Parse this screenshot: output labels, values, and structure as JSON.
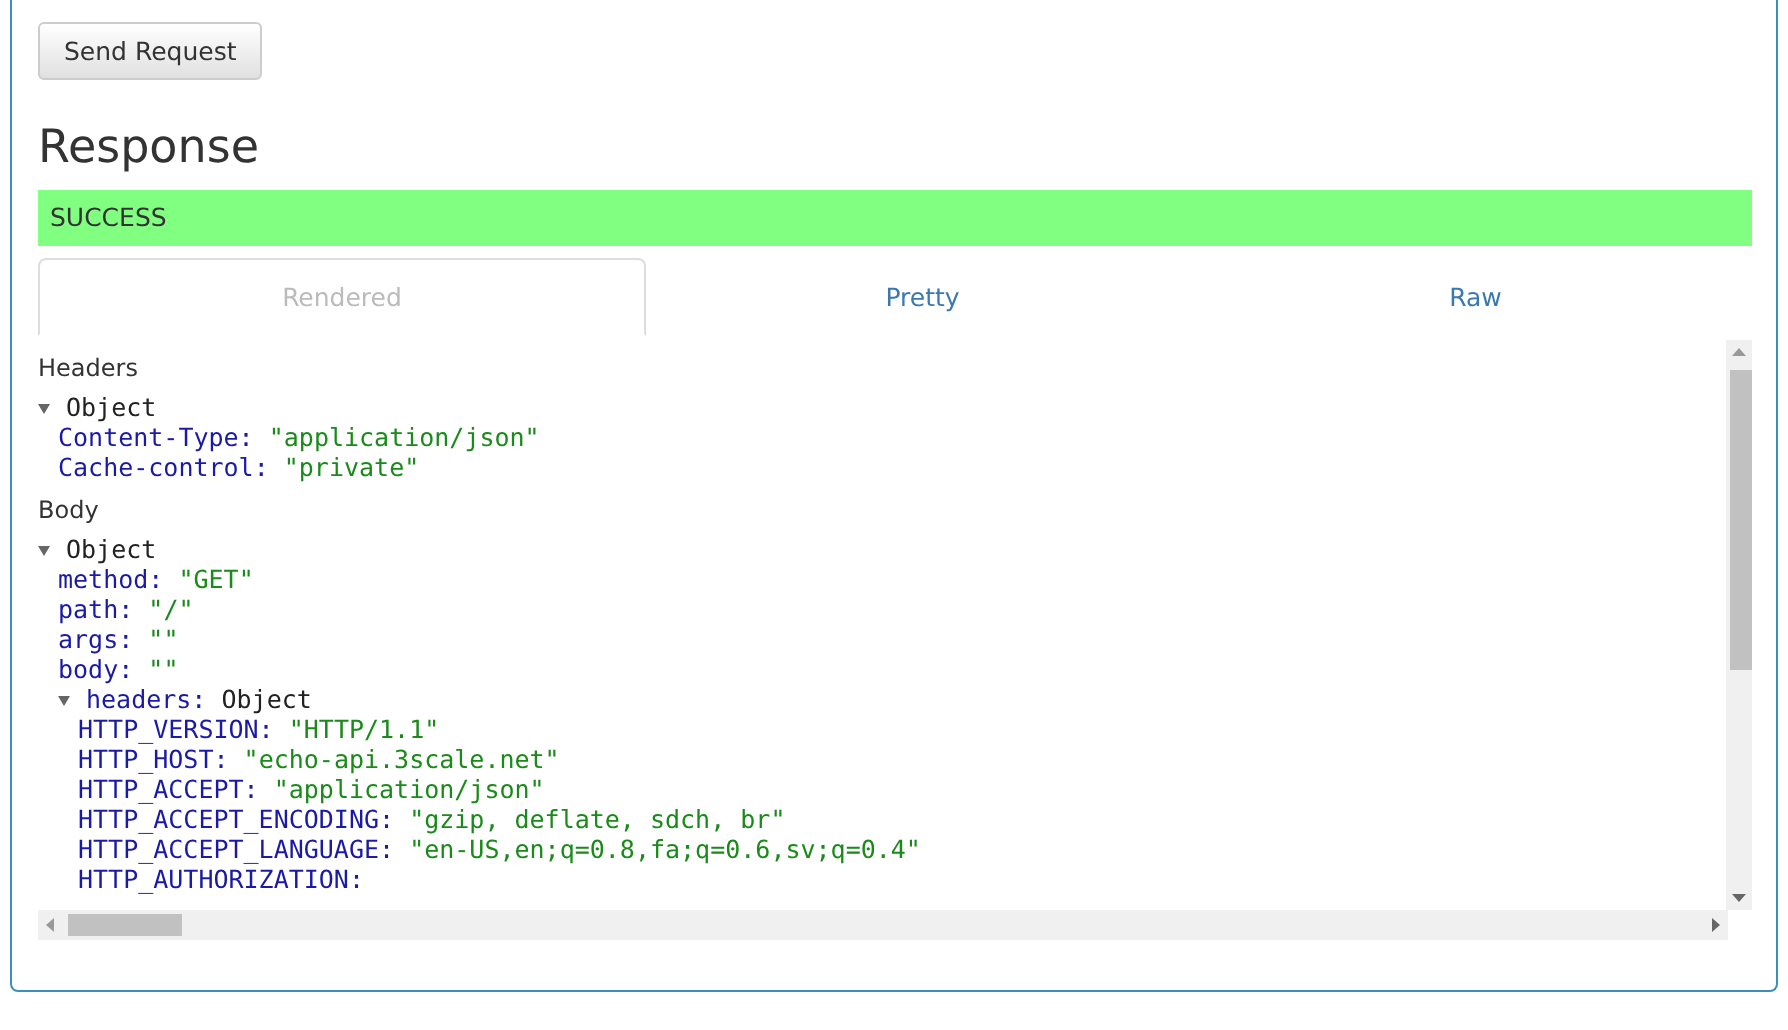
{
  "send_button": {
    "label": "Send Request"
  },
  "heading": "Response",
  "status": {
    "text": "SUCCESS",
    "kind": "success"
  },
  "tabs": [
    {
      "label": "Rendered",
      "selected": true
    },
    {
      "label": "Pretty",
      "selected": false
    },
    {
      "label": "Raw",
      "selected": false
    }
  ],
  "sections": [
    {
      "label": "Headers",
      "tree": {
        "label": "Object",
        "expanded": true,
        "children": [
          {
            "key": "Content-Type:",
            "value": "\"application/json\"",
            "kind": "string"
          },
          {
            "key": "Cache-control:",
            "value": "\"private\"",
            "kind": "string"
          }
        ]
      }
    },
    {
      "label": "Body",
      "tree": {
        "label": "Object",
        "expanded": true,
        "children": [
          {
            "key": "method:",
            "value": "\"GET\"",
            "kind": "string"
          },
          {
            "key": "path:",
            "value": "\"/\"",
            "kind": "string"
          },
          {
            "key": "args:",
            "value": "\"\"",
            "kind": "string"
          },
          {
            "key": "body:",
            "value": "\"\"",
            "kind": "string"
          },
          {
            "key": "headers:",
            "value": "Object",
            "kind": "object",
            "expanded": true,
            "children": [
              {
                "key": "HTTP_VERSION:",
                "value": "\"HTTP/1.1\"",
                "kind": "string"
              },
              {
                "key": "HTTP_HOST:",
                "value": "\"echo-api.3scale.net\"",
                "kind": "string"
              },
              {
                "key": "HTTP_ACCEPT:",
                "value": "\"application/json\"",
                "kind": "string"
              },
              {
                "key": "HTTP_ACCEPT_ENCODING:",
                "value": "\"gzip, deflate, sdch, br\"",
                "kind": "string"
              },
              {
                "key": "HTTP_ACCEPT_LANGUAGE:",
                "value": "\"en-US,en;q=0.8,fa;q=0.6,sv;q=0.4\"",
                "kind": "string"
              },
              {
                "key": "HTTP_AUTHORIZATION:",
                "kind": "pending"
              }
            ]
          }
        ]
      }
    }
  ]
}
